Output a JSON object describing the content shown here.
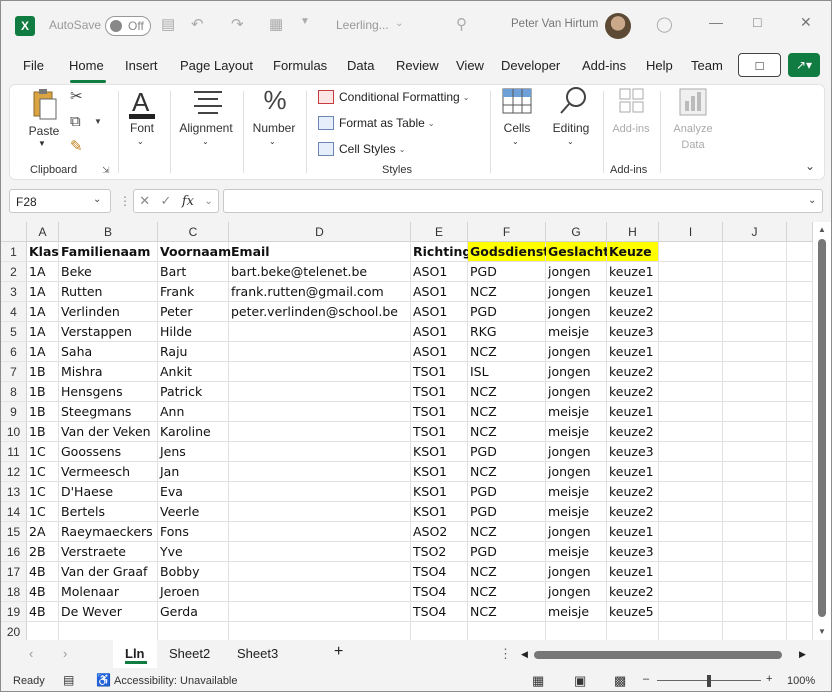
{
  "titlebar": {
    "autosave_label": "AutoSave",
    "autosave_state": "Off",
    "doc_title": "Leerling...",
    "user_name": "Peter Van Hirtum"
  },
  "menu": [
    "File",
    "Home",
    "Insert",
    "Page Layout",
    "Formulas",
    "Data",
    "Review",
    "View",
    "Developer",
    "Add-ins",
    "Help",
    "Team"
  ],
  "ribbon": {
    "paste": "Paste",
    "clipboard": "Clipboard",
    "font": "Font",
    "alignment": "Alignment",
    "number": "Number",
    "conditional_formatting": "Conditional Formatting",
    "format_as_table": "Format as Table",
    "cell_styles": "Cell Styles",
    "styles": "Styles",
    "cells": "Cells",
    "editing": "Editing",
    "addins_btn": "Add-ins",
    "addins_group": "Add-ins",
    "analyze_data_1": "Analyze",
    "analyze_data_2": "Data"
  },
  "formula_bar": {
    "name_box": "F28",
    "fx": "fx",
    "formula": ""
  },
  "columns": [
    "A",
    "B",
    "C",
    "D",
    "E",
    "F",
    "G",
    "H",
    "I",
    "J"
  ],
  "rows": [
    [
      "Klas",
      "Familienaam",
      "Voornaam",
      "Email",
      "Richting",
      "Godsdienst",
      "Geslacht",
      "Keuze",
      "",
      ""
    ],
    [
      "1A",
      "Beke",
      "Bart",
      "bart.beke@telenet.be",
      "ASO1",
      "PGD",
      "jongen",
      "keuze1",
      "",
      ""
    ],
    [
      "1A",
      "Rutten",
      "Frank",
      "frank.rutten@gmail.com",
      "ASO1",
      "NCZ",
      "jongen",
      "keuze1",
      "",
      ""
    ],
    [
      "1A",
      "Verlinden",
      "Peter",
      "peter.verlinden@school.be",
      "ASO1",
      "PGD",
      "jongen",
      "keuze2",
      "",
      ""
    ],
    [
      "1A",
      "Verstappen",
      "Hilde",
      "",
      "ASO1",
      "RKG",
      "meisje",
      "keuze3",
      "",
      ""
    ],
    [
      "1A",
      "Saha",
      "Raju",
      "",
      "ASO1",
      "NCZ",
      "jongen",
      "keuze1",
      "",
      ""
    ],
    [
      "1B",
      "Mishra",
      "Ankit",
      "",
      "TSO1",
      "ISL",
      "jongen",
      "keuze2",
      "",
      ""
    ],
    [
      "1B",
      "Hensgens",
      "Patrick",
      "",
      "TSO1",
      "NCZ",
      "jongen",
      "keuze2",
      "",
      ""
    ],
    [
      "1B",
      "Steegmans",
      "Ann",
      "",
      "TSO1",
      "NCZ",
      "meisje",
      "keuze1",
      "",
      ""
    ],
    [
      "1B",
      "Van der Veken",
      "Karoline",
      "",
      "TSO1",
      "NCZ",
      "meisje",
      "keuze2",
      "",
      ""
    ],
    [
      "1C",
      "Goossens",
      "Jens",
      "",
      "KSO1",
      "PGD",
      "jongen",
      "keuze3",
      "",
      ""
    ],
    [
      "1C",
      "Vermeesch",
      "Jan",
      "",
      "KSO1",
      "NCZ",
      "jongen",
      "keuze1",
      "",
      ""
    ],
    [
      "1C",
      "D'Haese",
      "Eva",
      "",
      "KSO1",
      "PGD",
      "meisje",
      "keuze2",
      "",
      ""
    ],
    [
      "1C",
      "Bertels",
      "Veerle",
      "",
      "KSO1",
      "PGD",
      "meisje",
      "keuze2",
      "",
      ""
    ],
    [
      "2A",
      "Raeymaeckers",
      "Fons",
      "",
      "ASO2",
      "NCZ",
      "jongen",
      "keuze1",
      "",
      ""
    ],
    [
      "2B",
      "Verstraete",
      "Yve",
      "",
      "TSO2",
      "PGD",
      "meisje",
      "keuze3",
      "",
      ""
    ],
    [
      "4B",
      "Van der Graaf",
      "Bobby",
      "",
      "TSO4",
      "NCZ",
      "jongen",
      "keuze1",
      "",
      ""
    ],
    [
      "4B",
      "Molenaar",
      "Jeroen",
      "",
      "TSO4",
      "NCZ",
      "jongen",
      "keuze2",
      "",
      ""
    ],
    [
      "4B",
      "De Wever",
      "Gerda",
      "",
      "TSO4",
      "NCZ",
      "meisje",
      "keuze5",
      "",
      ""
    ],
    [
      "",
      "",
      "",
      "",
      "",
      "",
      "",
      "",
      "",
      ""
    ]
  ],
  "highlight_color": "#ffff00",
  "sheets": [
    "Lln",
    "Sheet2",
    "Sheet3"
  ],
  "status": {
    "ready": "Ready",
    "accessibility": "Accessibility: Unavailable",
    "zoom": "100%"
  }
}
